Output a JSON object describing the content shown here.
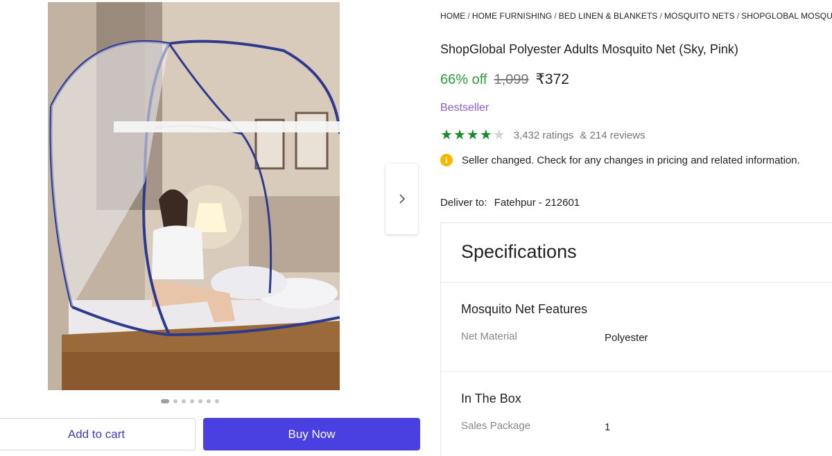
{
  "gallery": {
    "image_alt": "Woman sitting on bed inside pop-up mosquito net",
    "dot_count": 7,
    "active_dot": 0,
    "next_icon": "chevron-right-icon"
  },
  "actions": {
    "add_to_cart": "Add to cart",
    "buy_now": "Buy Now"
  },
  "breadcrumb": [
    "HOME",
    "HOME FURNISHING",
    "BED LINEN & BLANKETS",
    "MOSQUITO NETS",
    "SHOPGLOBAL MOSQUITO"
  ],
  "product": {
    "title": "ShopGlobal Polyester Adults Mosquito Net (Sky, Pink)",
    "discount": "66% off",
    "mrp": "1,099",
    "price": "₹372",
    "badge": "Bestseller",
    "rating_value": 4,
    "rating_max": 5,
    "ratings_count": "3,432 ratings",
    "reviews_count": "& 214 reviews"
  },
  "notice": {
    "icon": "info-icon",
    "text": "Seller changed. Check for any changes in pricing and related information."
  },
  "delivery": {
    "label": "Deliver to:",
    "location": "Fatehpur - 212601"
  },
  "specifications": {
    "title": "Specifications",
    "sections": [
      {
        "title": "Mosquito Net Features",
        "rows": [
          {
            "label": "Net Material",
            "value": "Polyester"
          }
        ]
      },
      {
        "title": "In The Box",
        "rows": [
          {
            "label": "Sales Package",
            "value": "1"
          }
        ]
      }
    ]
  },
  "colors": {
    "discount_green": "#2e9a3e",
    "bestseller_purple": "#8b5cc4",
    "buy_button": "#4a3fe0",
    "star_green": "#1b8a2e",
    "info_yellow": "#f5b700"
  }
}
